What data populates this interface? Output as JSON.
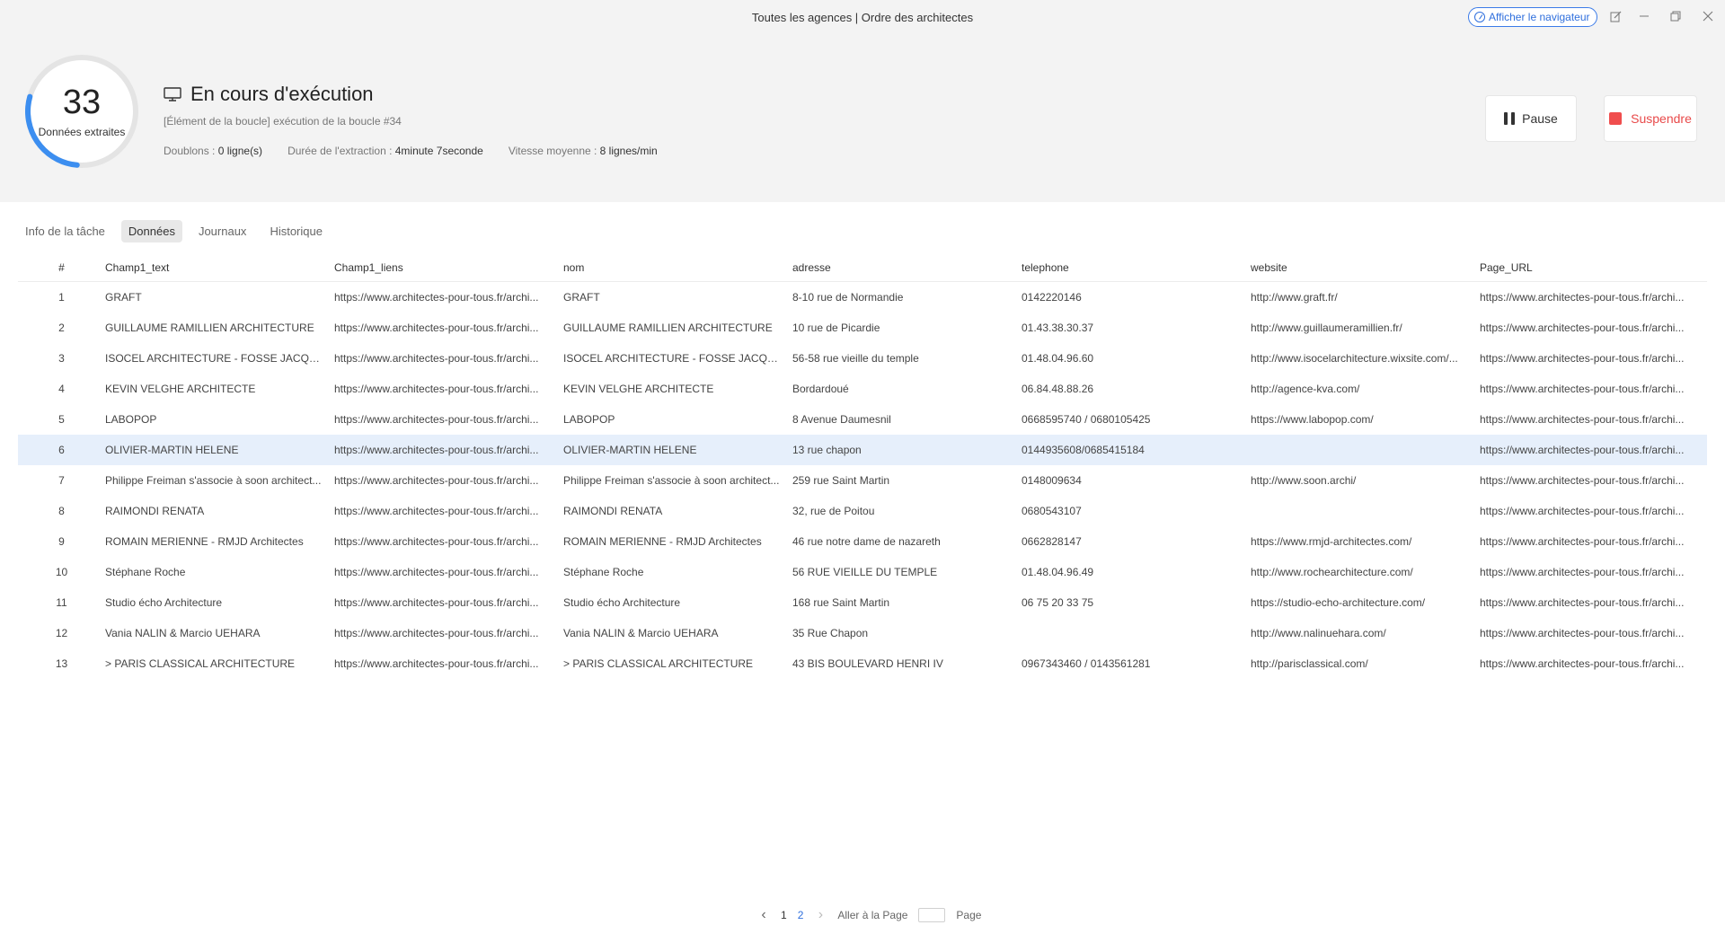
{
  "window": {
    "title": "Toutes les agences | Ordre des architectes",
    "browser_button": "Afficher le navigateur"
  },
  "summary": {
    "count": "33",
    "count_label": "Données extraites",
    "progress": 0.28,
    "status": "En cours d'exécution",
    "loop_info": "[Élément de la boucle] exécution de la boucle #34",
    "duplicates_label": "Doublons : ",
    "duplicates_value": "0 ligne(s)",
    "duration_label": "Durée de l'extraction : ",
    "duration_value": "4minute 7seconde",
    "speed_label": "Vitesse moyenne : ",
    "speed_value": "8 lignes/min"
  },
  "actions": {
    "pause": "Pause",
    "stop": "Suspendre"
  },
  "tabs": [
    {
      "label": "Info de la tâche"
    },
    {
      "label": "Données"
    },
    {
      "label": "Journaux"
    },
    {
      "label": "Historique"
    }
  ],
  "table": {
    "columns": [
      "#",
      "Champ1_text",
      "Champ1_liens",
      "nom",
      "adresse",
      "telephone",
      "website",
      "Page_URL"
    ],
    "rows": [
      [
        "1",
        "GRAFT",
        "https://www.architectes-pour-tous.fr/archi...",
        "GRAFT",
        "8-10 rue de Normandie",
        "0142220146",
        "http://www.graft.fr/",
        "https://www.architectes-pour-tous.fr/archi..."
      ],
      [
        "2",
        "GUILLAUME RAMILLIEN ARCHITECTURE",
        "https://www.architectes-pour-tous.fr/archi...",
        "GUILLAUME RAMILLIEN ARCHITECTURE",
        "10 rue de Picardie",
        "01.43.38.30.37",
        "http://www.guillaumeramillien.fr/",
        "https://www.architectes-pour-tous.fr/archi..."
      ],
      [
        "3",
        "ISOCEL ARCHITECTURE - FOSSE JACQUES-...",
        "https://www.architectes-pour-tous.fr/archi...",
        "ISOCEL ARCHITECTURE - FOSSE JACQUES-...",
        "56-58 rue vieille du temple",
        "01.48.04.96.60",
        "http://www.isocelarchitecture.wixsite.com/...",
        "https://www.architectes-pour-tous.fr/archi..."
      ],
      [
        "4",
        "KEVIN VELGHE ARCHITECTE",
        "https://www.architectes-pour-tous.fr/archi...",
        "KEVIN VELGHE ARCHITECTE",
        "Bordardoué",
        "06.84.48.88.26",
        "http://agence-kva.com/",
        "https://www.architectes-pour-tous.fr/archi..."
      ],
      [
        "5",
        "LABOPOP",
        "https://www.architectes-pour-tous.fr/archi...",
        "LABOPOP",
        "8 Avenue Daumesnil",
        "0668595740 / 0680105425",
        "https://www.labopop.com/",
        "https://www.architectes-pour-tous.fr/archi..."
      ],
      [
        "6",
        "OLIVIER-MARTIN HELENE",
        "https://www.architectes-pour-tous.fr/archi...",
        "OLIVIER-MARTIN HELENE",
        "13 rue chapon",
        "0144935608/0685415184",
        "",
        "https://www.architectes-pour-tous.fr/archi..."
      ],
      [
        "7",
        "Philippe Freiman s'associe à soon architect...",
        "https://www.architectes-pour-tous.fr/archi...",
        "Philippe Freiman s'associe à soon architect...",
        "259 rue Saint Martin",
        "0148009634",
        "http://www.soon.archi/",
        "https://www.architectes-pour-tous.fr/archi..."
      ],
      [
        "8",
        "RAIMONDI RENATA",
        "https://www.architectes-pour-tous.fr/archi...",
        "RAIMONDI RENATA",
        "32, rue de Poitou",
        "0680543107",
        "",
        "https://www.architectes-pour-tous.fr/archi..."
      ],
      [
        "9",
        "ROMAIN MERIENNE - RMJD Architectes",
        "https://www.architectes-pour-tous.fr/archi...",
        "ROMAIN MERIENNE - RMJD Architectes",
        "46 rue notre dame de nazareth",
        "0662828147",
        "https://www.rmjd-architectes.com/",
        "https://www.architectes-pour-tous.fr/archi..."
      ],
      [
        "10",
        "Stéphane Roche",
        "https://www.architectes-pour-tous.fr/archi...",
        "Stéphane Roche",
        "56 RUE VIEILLE DU TEMPLE",
        "01.48.04.96.49",
        "http://www.rochearchitecture.com/",
        "https://www.architectes-pour-tous.fr/archi..."
      ],
      [
        "11",
        "Studio écho Architecture",
        "https://www.architectes-pour-tous.fr/archi...",
        "Studio écho Architecture",
        "168 rue Saint Martin",
        "06 75 20 33 75",
        "https://studio-echo-architecture.com/",
        "https://www.architectes-pour-tous.fr/archi..."
      ],
      [
        "12",
        "Vania NALIN & Marcio UEHARA",
        "https://www.architectes-pour-tous.fr/archi...",
        "Vania NALIN & Marcio UEHARA",
        "35 Rue Chapon",
        "",
        "http://www.nalinuehara.com/",
        "https://www.architectes-pour-tous.fr/archi..."
      ],
      [
        "13",
        "> PARIS CLASSICAL ARCHITECTURE",
        "https://www.architectes-pour-tous.fr/archi...",
        "> PARIS CLASSICAL ARCHITECTURE",
        "43 BIS BOULEVARD HENRI IV",
        "0967343460 / 0143561281",
        "http://parisclassical.com/",
        "https://www.architectes-pour-tous.fr/archi..."
      ]
    ]
  },
  "pagination": {
    "pages": [
      "1",
      "2"
    ],
    "goto_label": "Aller à la Page",
    "page_suffix": "Page"
  }
}
